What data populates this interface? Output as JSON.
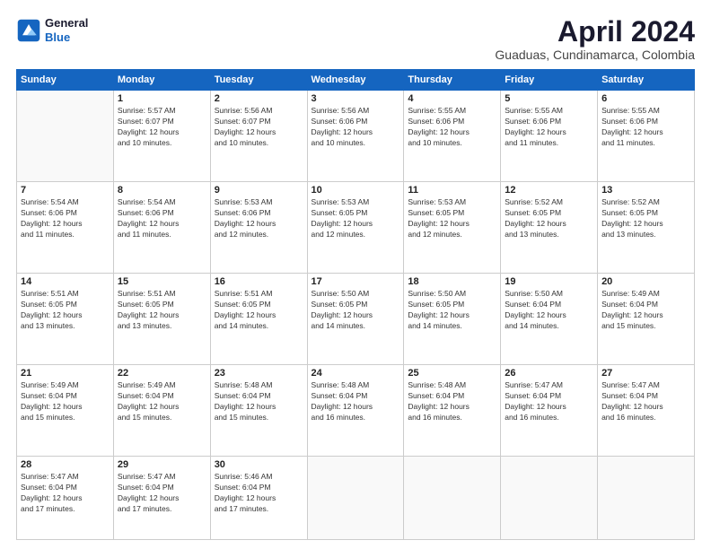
{
  "logo": {
    "line1": "General",
    "line2": "Blue"
  },
  "title": "April 2024",
  "subtitle": "Guaduas, Cundinamarca, Colombia",
  "days": [
    "Sunday",
    "Monday",
    "Tuesday",
    "Wednesday",
    "Thursday",
    "Friday",
    "Saturday"
  ],
  "weeks": [
    [
      {
        "num": "",
        "info": ""
      },
      {
        "num": "1",
        "info": "Sunrise: 5:57 AM\nSunset: 6:07 PM\nDaylight: 12 hours\nand 10 minutes."
      },
      {
        "num": "2",
        "info": "Sunrise: 5:56 AM\nSunset: 6:07 PM\nDaylight: 12 hours\nand 10 minutes."
      },
      {
        "num": "3",
        "info": "Sunrise: 5:56 AM\nSunset: 6:06 PM\nDaylight: 12 hours\nand 10 minutes."
      },
      {
        "num": "4",
        "info": "Sunrise: 5:55 AM\nSunset: 6:06 PM\nDaylight: 12 hours\nand 10 minutes."
      },
      {
        "num": "5",
        "info": "Sunrise: 5:55 AM\nSunset: 6:06 PM\nDaylight: 12 hours\nand 11 minutes."
      },
      {
        "num": "6",
        "info": "Sunrise: 5:55 AM\nSunset: 6:06 PM\nDaylight: 12 hours\nand 11 minutes."
      }
    ],
    [
      {
        "num": "7",
        "info": "Sunrise: 5:54 AM\nSunset: 6:06 PM\nDaylight: 12 hours\nand 11 minutes."
      },
      {
        "num": "8",
        "info": "Sunrise: 5:54 AM\nSunset: 6:06 PM\nDaylight: 12 hours\nand 11 minutes."
      },
      {
        "num": "9",
        "info": "Sunrise: 5:53 AM\nSunset: 6:06 PM\nDaylight: 12 hours\nand 12 minutes."
      },
      {
        "num": "10",
        "info": "Sunrise: 5:53 AM\nSunset: 6:05 PM\nDaylight: 12 hours\nand 12 minutes."
      },
      {
        "num": "11",
        "info": "Sunrise: 5:53 AM\nSunset: 6:05 PM\nDaylight: 12 hours\nand 12 minutes."
      },
      {
        "num": "12",
        "info": "Sunrise: 5:52 AM\nSunset: 6:05 PM\nDaylight: 12 hours\nand 13 minutes."
      },
      {
        "num": "13",
        "info": "Sunrise: 5:52 AM\nSunset: 6:05 PM\nDaylight: 12 hours\nand 13 minutes."
      }
    ],
    [
      {
        "num": "14",
        "info": "Sunrise: 5:51 AM\nSunset: 6:05 PM\nDaylight: 12 hours\nand 13 minutes."
      },
      {
        "num": "15",
        "info": "Sunrise: 5:51 AM\nSunset: 6:05 PM\nDaylight: 12 hours\nand 13 minutes."
      },
      {
        "num": "16",
        "info": "Sunrise: 5:51 AM\nSunset: 6:05 PM\nDaylight: 12 hours\nand 14 minutes."
      },
      {
        "num": "17",
        "info": "Sunrise: 5:50 AM\nSunset: 6:05 PM\nDaylight: 12 hours\nand 14 minutes."
      },
      {
        "num": "18",
        "info": "Sunrise: 5:50 AM\nSunset: 6:05 PM\nDaylight: 12 hours\nand 14 minutes."
      },
      {
        "num": "19",
        "info": "Sunrise: 5:50 AM\nSunset: 6:04 PM\nDaylight: 12 hours\nand 14 minutes."
      },
      {
        "num": "20",
        "info": "Sunrise: 5:49 AM\nSunset: 6:04 PM\nDaylight: 12 hours\nand 15 minutes."
      }
    ],
    [
      {
        "num": "21",
        "info": "Sunrise: 5:49 AM\nSunset: 6:04 PM\nDaylight: 12 hours\nand 15 minutes."
      },
      {
        "num": "22",
        "info": "Sunrise: 5:49 AM\nSunset: 6:04 PM\nDaylight: 12 hours\nand 15 minutes."
      },
      {
        "num": "23",
        "info": "Sunrise: 5:48 AM\nSunset: 6:04 PM\nDaylight: 12 hours\nand 15 minutes."
      },
      {
        "num": "24",
        "info": "Sunrise: 5:48 AM\nSunset: 6:04 PM\nDaylight: 12 hours\nand 16 minutes."
      },
      {
        "num": "25",
        "info": "Sunrise: 5:48 AM\nSunset: 6:04 PM\nDaylight: 12 hours\nand 16 minutes."
      },
      {
        "num": "26",
        "info": "Sunrise: 5:47 AM\nSunset: 6:04 PM\nDaylight: 12 hours\nand 16 minutes."
      },
      {
        "num": "27",
        "info": "Sunrise: 5:47 AM\nSunset: 6:04 PM\nDaylight: 12 hours\nand 16 minutes."
      }
    ],
    [
      {
        "num": "28",
        "info": "Sunrise: 5:47 AM\nSunset: 6:04 PM\nDaylight: 12 hours\nand 17 minutes."
      },
      {
        "num": "29",
        "info": "Sunrise: 5:47 AM\nSunset: 6:04 PM\nDaylight: 12 hours\nand 17 minutes."
      },
      {
        "num": "30",
        "info": "Sunrise: 5:46 AM\nSunset: 6:04 PM\nDaylight: 12 hours\nand 17 minutes."
      },
      {
        "num": "",
        "info": ""
      },
      {
        "num": "",
        "info": ""
      },
      {
        "num": "",
        "info": ""
      },
      {
        "num": "",
        "info": ""
      }
    ]
  ]
}
